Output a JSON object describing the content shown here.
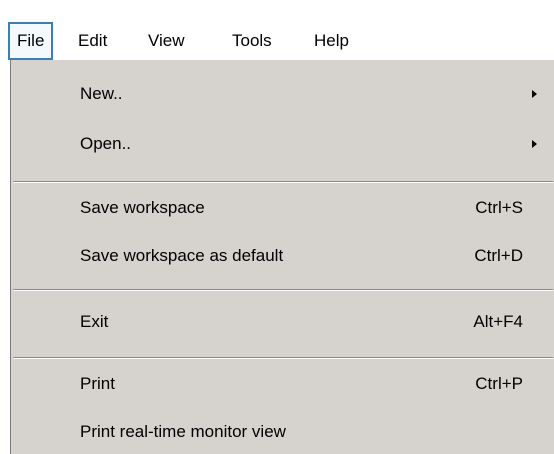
{
  "menubar": {
    "items": [
      {
        "label": "File"
      },
      {
        "label": "Edit"
      },
      {
        "label": "View"
      },
      {
        "label": "Tools"
      },
      {
        "label": "Help"
      }
    ]
  },
  "file_menu": {
    "items": [
      {
        "label": "New..",
        "has_submenu": true
      },
      {
        "label": "Open..",
        "has_submenu": true
      },
      {
        "label": "Save workspace",
        "shortcut": "Ctrl+S"
      },
      {
        "label": "Save workspace as default",
        "shortcut": "Ctrl+D"
      },
      {
        "label": "Exit",
        "shortcut": "Alt+F4"
      },
      {
        "label": "Print",
        "shortcut": "Ctrl+P"
      },
      {
        "label": "Print real-time monitor view"
      }
    ]
  },
  "colors": {
    "menu_background": "#d6d3ce",
    "active_menu_border": "#3c7fb1",
    "separator": "#8d8a85"
  }
}
